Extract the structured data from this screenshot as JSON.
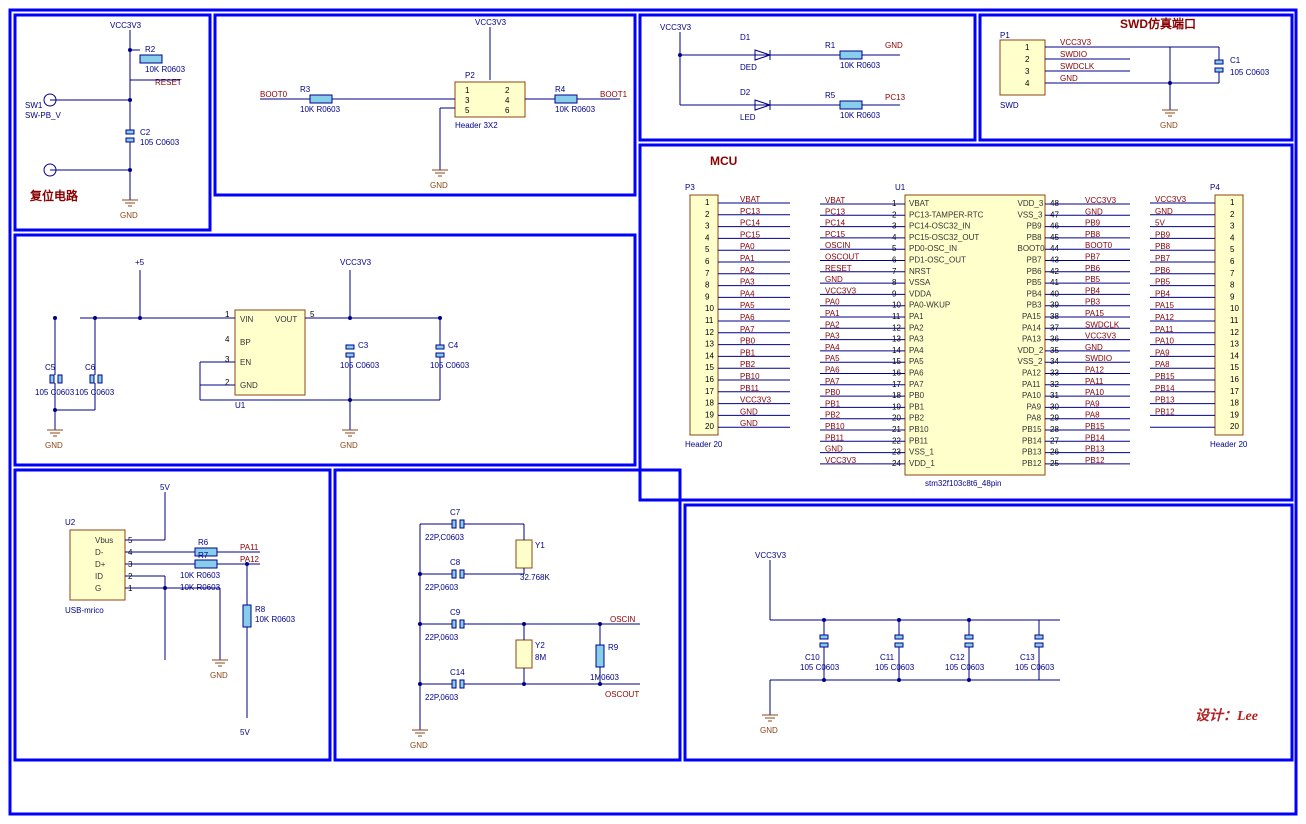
{
  "blocks": {
    "reset": {
      "title": "复位电路",
      "r2": "R2",
      "r2v": "10K R0603",
      "c2": "C2",
      "c2v": "105 C0603",
      "sw": "SW1",
      "swm": "SW-PB_V",
      "vcc": "VCC3V3",
      "gnd": "GND",
      "net": "RESET"
    },
    "boot": {
      "p2": "P2",
      "p2m": "Header 3X2",
      "r3": "R3",
      "r3v": "10K R0603",
      "r4": "R4",
      "r4v": "10K R0603",
      "vcc": "VCC3V3",
      "gnd": "GND",
      "b0": "BOOT0",
      "b1": "BOOT1"
    },
    "led": {
      "d1": "D1",
      "d1m": "DED",
      "d2": "D2",
      "d2m": "LED",
      "r1": "R1",
      "r1v": "10K R0603",
      "r5": "R5",
      "r5v": "10K R0603",
      "vcc": "VCC3V3",
      "gnd": "GND",
      "pc13": "PC13"
    },
    "swd": {
      "title": "SWD仿真端口",
      "p1": "P1",
      "p1m": "SWD",
      "c1": "C1",
      "c1v": "105 C0603",
      "s1": "VCC3V3",
      "s2": "SWDIO",
      "s3": "SWDCLK",
      "s4": "GND",
      "gnd": "GND"
    },
    "vreg": {
      "u1": "U1",
      "p5": "+5",
      "vcc": "VCC3V3",
      "c5": "C5",
      "c5v": "105 C0603",
      "c6": "C6",
      "c6v": "105 C0603",
      "c3": "C3",
      "c3v": "105 C0603",
      "c4": "C4",
      "c4v": "105 C0603",
      "vin": "VIN",
      "vout": "VOUT",
      "bp": "BP",
      "en": "EN",
      "g": "GND",
      "gnd": "GND"
    },
    "usb": {
      "u2": "U2",
      "u2m": "USB-mrico",
      "r6": "R6",
      "r7": "R7",
      "r8": "R8",
      "rv": "10K R0603",
      "p5": "5V",
      "pa11": "PA11",
      "pa12": "PA12",
      "gnd": "GND",
      "vbus": "Vbus",
      "dm": "D-",
      "dp": "D+",
      "id": "ID",
      "g": "G"
    },
    "osc": {
      "c7": "C7",
      "c8": "C8",
      "c9": "C9",
      "c14": "C14",
      "cv": "22P,0603",
      "cv2": "22P,C0603",
      "y1": "Y1",
      "y1v": "32.768K",
      "y2": "Y2",
      "y2v": "8M",
      "r9": "R9",
      "r9v": "1M0603",
      "oscin": "OSCIN",
      "oscout": "OSCOUT",
      "gnd": "GND"
    },
    "decouple": {
      "c10": "C10",
      "c11": "C11",
      "c12": "C12",
      "c13": "C13",
      "cv": "105 C0603",
      "vcc": "VCC3V3",
      "gnd": "GND"
    },
    "mcu": {
      "title": "MCU",
      "u1": "U1",
      "u1m": "stm32f103c8t6_48pin",
      "p3": "P3",
      "p4": "P4",
      "hm": "Header 20"
    }
  },
  "mcu_left_pins": [
    {
      "n": "1",
      "l": "VBAT"
    },
    {
      "n": "2",
      "l": "PC13-TAMPER-RTC"
    },
    {
      "n": "3",
      "l": "PC14-OSC32_IN"
    },
    {
      "n": "4",
      "l": "PC15-OSC32_OUT"
    },
    {
      "n": "5",
      "l": "PD0-OSC_IN"
    },
    {
      "n": "6",
      "l": "PD1-OSC_OUT"
    },
    {
      "n": "7",
      "l": "NRST"
    },
    {
      "n": "8",
      "l": "VSSA"
    },
    {
      "n": "9",
      "l": "VDDA"
    },
    {
      "n": "10",
      "l": "PA0-WKUP"
    },
    {
      "n": "11",
      "l": "PA1"
    },
    {
      "n": "12",
      "l": "PA2"
    },
    {
      "n": "13",
      "l": "PA3"
    },
    {
      "n": "14",
      "l": "PA4"
    },
    {
      "n": "15",
      "l": "PA5"
    },
    {
      "n": "16",
      "l": "PA6"
    },
    {
      "n": "17",
      "l": "PA7"
    },
    {
      "n": "18",
      "l": "PB0"
    },
    {
      "n": "19",
      "l": "PB1"
    },
    {
      "n": "20",
      "l": "PB2"
    },
    {
      "n": "21",
      "l": "PB10"
    },
    {
      "n": "22",
      "l": "PB11"
    },
    {
      "n": "23",
      "l": "VSS_1"
    },
    {
      "n": "24",
      "l": "VDD_1"
    }
  ],
  "mcu_right_pins": [
    {
      "n": "48",
      "l": "VDD_3"
    },
    {
      "n": "47",
      "l": "VSS_3"
    },
    {
      "n": "46",
      "l": "PB9"
    },
    {
      "n": "45",
      "l": "PB8"
    },
    {
      "n": "44",
      "l": "BOOT0"
    },
    {
      "n": "43",
      "l": "PB7"
    },
    {
      "n": "42",
      "l": "PB6"
    },
    {
      "n": "41",
      "l": "PB5"
    },
    {
      "n": "40",
      "l": "PB4"
    },
    {
      "n": "39",
      "l": "PB3"
    },
    {
      "n": "38",
      "l": "PA15"
    },
    {
      "n": "37",
      "l": "PA14"
    },
    {
      "n": "36",
      "l": "PA13"
    },
    {
      "n": "35",
      "l": "VDD_2"
    },
    {
      "n": "34",
      "l": "VSS_2"
    },
    {
      "n": "33",
      "l": "PA12"
    },
    {
      "n": "32",
      "l": "PA11"
    },
    {
      "n": "31",
      "l": "PA10"
    },
    {
      "n": "30",
      "l": "PA9"
    },
    {
      "n": "29",
      "l": "PA8"
    },
    {
      "n": "28",
      "l": "PB15"
    },
    {
      "n": "27",
      "l": "PB14"
    },
    {
      "n": "26",
      "l": "PB13"
    },
    {
      "n": "25",
      "l": "PB12"
    }
  ],
  "mcu_left_nets": [
    "VBAT",
    "PC13",
    "PC14",
    "PC15",
    "OSCIN",
    "OSCOUT",
    "RESET",
    "GND",
    "VCC3V3",
    "PA0",
    "PA1",
    "PA2",
    "PA3",
    "PA4",
    "PA5",
    "PA6",
    "PA7",
    "PB0",
    "PB1",
    "PB2",
    "PB10",
    "PB11",
    "GND",
    "VCC3V3"
  ],
  "mcu_right_nets": [
    "VCC3V3",
    "GND",
    "PB9",
    "PB8",
    "BOOT0",
    "PB7",
    "PB6",
    "PB5",
    "PB4",
    "PB3",
    "PA15",
    "SWDCLK",
    "VCC3V3",
    "GND",
    "SWDIO",
    "PA12",
    "PA11",
    "PA10",
    "PA9",
    "PA8",
    "PB15",
    "PB14",
    "PB13",
    "PB12"
  ],
  "p3_nets": [
    "VBAT",
    "PC13",
    "PC14",
    "PC15",
    "PA0",
    "PA1",
    "PA2",
    "PA3",
    "PA4",
    "PA5",
    "PA6",
    "PA7",
    "PB0",
    "PB1",
    "PB2",
    "PB10",
    "PB11",
    "VCC3V3",
    "GND",
    "GND"
  ],
  "p4_nets": [
    "VCC3V3",
    "GND",
    "5V",
    "PB9",
    "PB8",
    "PB7",
    "PB6",
    "PB5",
    "PB4",
    "PA15",
    "PA12",
    "PA11",
    "PA10",
    "PA9",
    "PA8",
    "PB15",
    "PB14",
    "PB13",
    "PB12",
    ""
  ],
  "designer": "设计：Lee"
}
